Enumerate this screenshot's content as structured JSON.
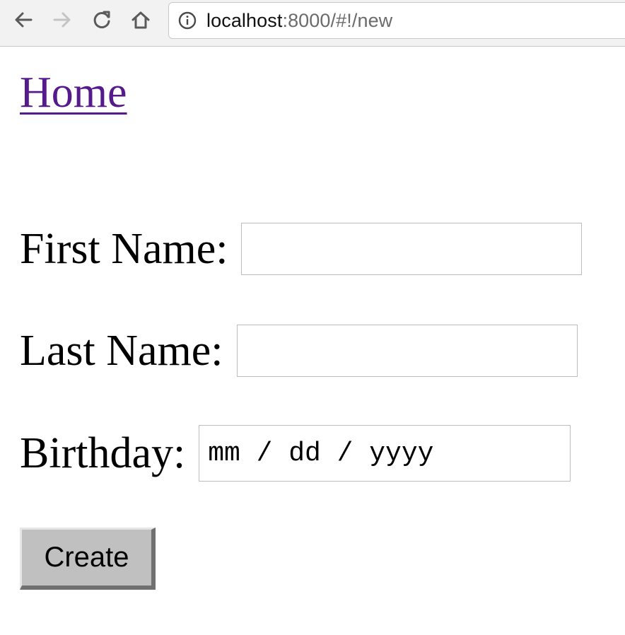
{
  "browser": {
    "url_host": "localhost",
    "url_rest": ":8000/#!/new",
    "icons": {
      "back": "back-arrow-icon",
      "forward": "forward-arrow-icon",
      "reload": "reload-icon",
      "home": "home-icon",
      "info": "info-icon"
    }
  },
  "page": {
    "home_link": "Home",
    "form": {
      "first_name_label": "First Name:",
      "first_name_value": "",
      "last_name_label": "Last Name:",
      "last_name_value": "",
      "birthday_label": "Birthday:",
      "birthday_placeholder": "mm / dd / yyyy",
      "create_label": "Create"
    }
  },
  "colors": {
    "link_visited": "#551a8b",
    "button_face": "#c0c0c0"
  }
}
